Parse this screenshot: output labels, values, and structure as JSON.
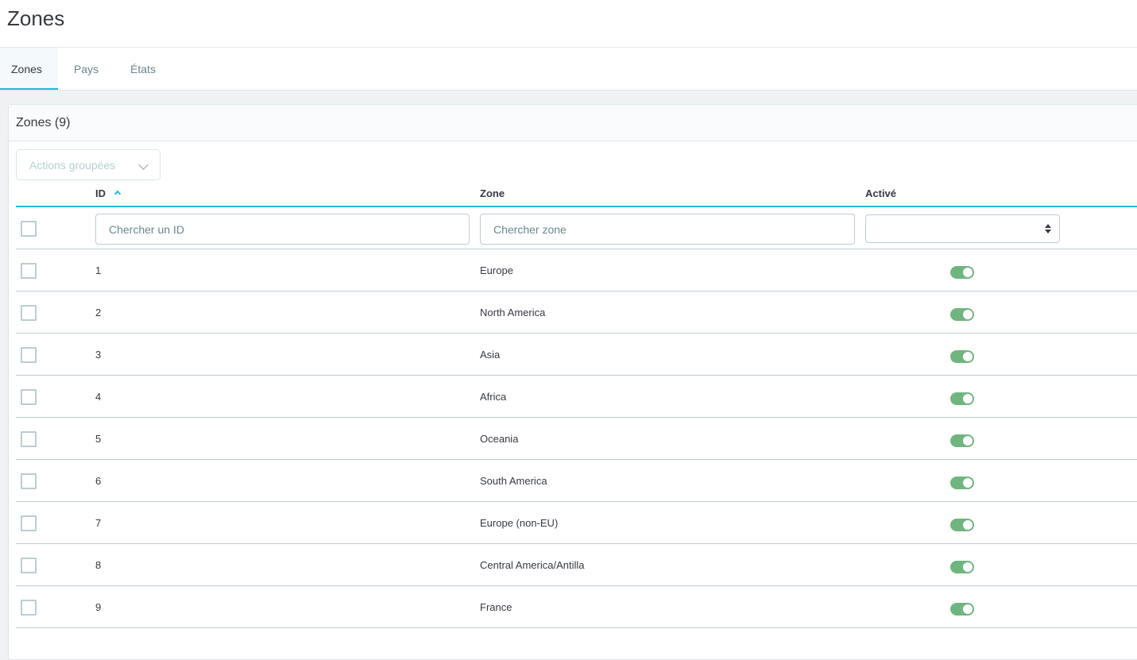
{
  "page": {
    "title": "Zones"
  },
  "tabs": [
    {
      "label": "Zones",
      "active": true
    },
    {
      "label": "Pays",
      "active": false
    },
    {
      "label": "États",
      "active": false
    }
  ],
  "card": {
    "title": "Zones (9)"
  },
  "bulk_actions": {
    "label": "Actions groupées"
  },
  "columns": {
    "id": "ID",
    "zone": "Zone",
    "active": "Activé"
  },
  "filters": {
    "id_placeholder": "Chercher un ID",
    "zone_placeholder": "Chercher zone",
    "active_value": ""
  },
  "rows": [
    {
      "id": "1",
      "zone": "Europe",
      "active": true
    },
    {
      "id": "2",
      "zone": "North America",
      "active": true
    },
    {
      "id": "3",
      "zone": "Asia",
      "active": true
    },
    {
      "id": "4",
      "zone": "Africa",
      "active": true
    },
    {
      "id": "5",
      "zone": "Oceania",
      "active": true
    },
    {
      "id": "6",
      "zone": "South America",
      "active": true
    },
    {
      "id": "7",
      "zone": "Europe (non-EU)",
      "active": true
    },
    {
      "id": "8",
      "zone": "Central America/Antilla",
      "active": true
    },
    {
      "id": "9",
      "zone": "France",
      "active": true
    }
  ],
  "colors": {
    "accent": "#25b9d7",
    "toggle_on": "#70b580"
  },
  "icons": {
    "sort": "chevron-up-icon",
    "bulk": "chevron-down-icon",
    "select": "sort-arrows-icon"
  }
}
